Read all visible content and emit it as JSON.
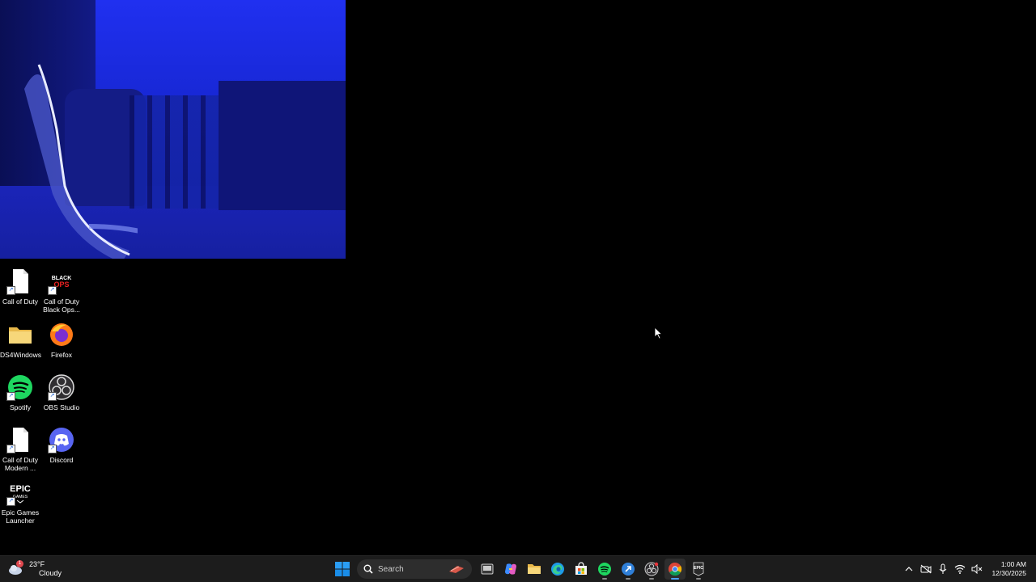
{
  "desktop": {
    "icons": [
      {
        "label": "Call of Duty",
        "icon": "blank-document-icon"
      },
      {
        "label": "Call of Duty Black Ops...",
        "icon": "black-ops-icon",
        "logo_text": "BLACK OPS"
      },
      {
        "label": "DS4Windows",
        "icon": "folder-icon"
      },
      {
        "label": "Firefox",
        "icon": "firefox-icon"
      },
      {
        "label": "Spotify",
        "icon": "spotify-icon"
      },
      {
        "label": "OBS Studio",
        "icon": "obs-icon"
      },
      {
        "label": "Call of Duty Modern ...",
        "icon": "blank-document-icon"
      },
      {
        "label": "Discord",
        "icon": "discord-icon"
      },
      {
        "label": "Epic Games Launcher",
        "icon": "epic-games-icon",
        "logo_text": "EPIC GAMES"
      }
    ]
  },
  "taskbar": {
    "weather": {
      "temperature": "23°F",
      "condition": "Cloudy",
      "alert_count": "1"
    },
    "search_label": "Search",
    "pinned_apps": [
      "start",
      "search",
      "task-view",
      "copilot",
      "file-explorer",
      "edge",
      "microsoft-store",
      "spotify",
      "remote-desktop",
      "obs",
      "chrome",
      "epic-games"
    ],
    "clock": {
      "time": "1:00 AM",
      "date": "12/30/2025"
    }
  },
  "colors": {
    "taskbar_bg": "#1c1c1c",
    "desktop_bg": "#000000",
    "accent": "#0078d4"
  }
}
